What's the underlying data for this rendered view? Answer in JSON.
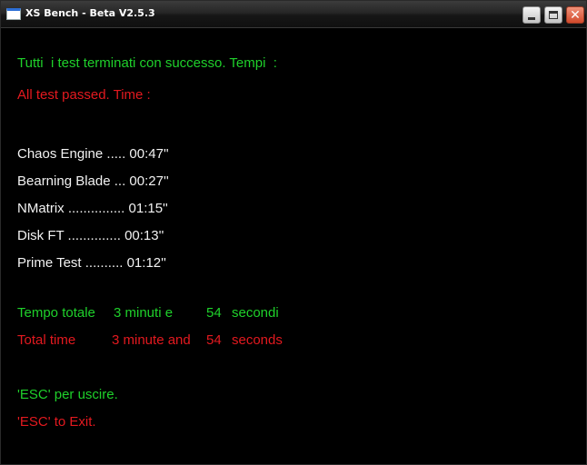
{
  "window": {
    "title": "XS Bench - Beta V2.5.3"
  },
  "messages": {
    "success_it": "Tutti  i test terminati con successo. Tempi  :",
    "success_en": "All test passed. Time :"
  },
  "results": [
    {
      "text": "Chaos Engine ..... 00:47''"
    },
    {
      "text": "Bearning Blade ... 00:27''"
    },
    {
      "text": "NMatrix ............... 01:15''"
    },
    {
      "text": "Disk FT .............. 00:13''"
    },
    {
      "text": "Prime Test .......... 01:12''"
    }
  ],
  "total_it": {
    "label": "Tempo totale",
    "minutes": "3 minuti e",
    "seconds_value": "54",
    "seconds_unit": "secondi"
  },
  "total_en": {
    "label": "Total time",
    "minutes": "3 minute and",
    "seconds_value": "54",
    "seconds_unit": "seconds"
  },
  "exit": {
    "it": "'ESC' per uscire.",
    "en": "'ESC' to Exit."
  },
  "colors": {
    "green": "#1fd12b",
    "red": "#e3191f",
    "white": "#f2f2f2",
    "background": "#000000"
  },
  "icons": {
    "app": "window-app-icon",
    "minimize": "minimize-icon",
    "maximize": "maximize-icon",
    "close": "close-icon"
  }
}
